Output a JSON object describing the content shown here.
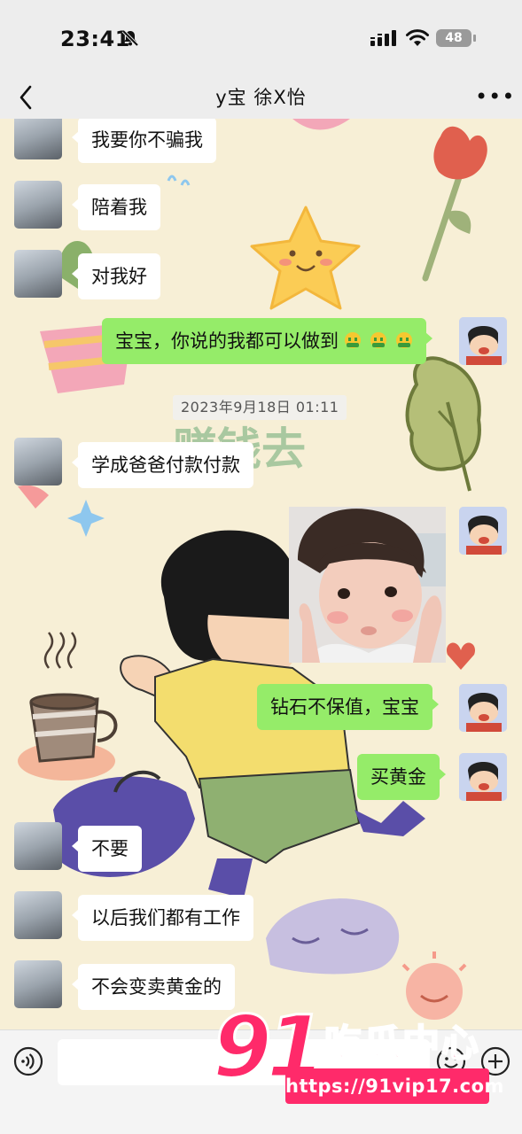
{
  "status_bar": {
    "time": "23:41",
    "battery": "48",
    "icons": [
      "bell-muted-icon",
      "signal-icon",
      "wifi-icon",
      "battery-icon"
    ]
  },
  "header": {
    "title": "y宝 徐X怡",
    "back_icon": "chevron-left-icon",
    "more_icon": "ellipsis-icon"
  },
  "messages": [
    {
      "side": "left",
      "text": "我要你不骗我"
    },
    {
      "side": "left",
      "text": "陪着我"
    },
    {
      "side": "left",
      "text": "对我好"
    },
    {
      "side": "right",
      "text": "宝宝，你说的我都可以做到",
      "emojis": [
        "money-face-emoji",
        "money-face-emoji",
        "money-face-emoji"
      ]
    },
    {
      "type": "timestamp",
      "text": "2023年9月18日 01:11"
    },
    {
      "side": "left",
      "text": "学成爸爸付款付款"
    },
    {
      "side": "right",
      "type": "image",
      "description_icon": "baby-photo"
    },
    {
      "side": "right",
      "text": "钻石不保值，宝宝"
    },
    {
      "side": "right",
      "text": "买黄金"
    },
    {
      "side": "left",
      "text": "不要"
    },
    {
      "side": "left",
      "text": "以后我们都有工作"
    },
    {
      "side": "left",
      "text": "不会变卖黄金的"
    }
  ],
  "background_text": "赚钱去",
  "input_bar": {
    "voice_icon": "voice-icon",
    "emoji_icon": "emoji-icon",
    "plus_icon": "plus-icon"
  },
  "watermark": {
    "number": "91",
    "name": "吃瓜中心",
    "url": "https://91vip17.com"
  },
  "colors": {
    "bubble_self": "#95ec69",
    "bubble_other": "#ffffff",
    "chat_background": "#f7efd6",
    "bar_background": "#ededed",
    "watermark": "#ff2a6a"
  }
}
